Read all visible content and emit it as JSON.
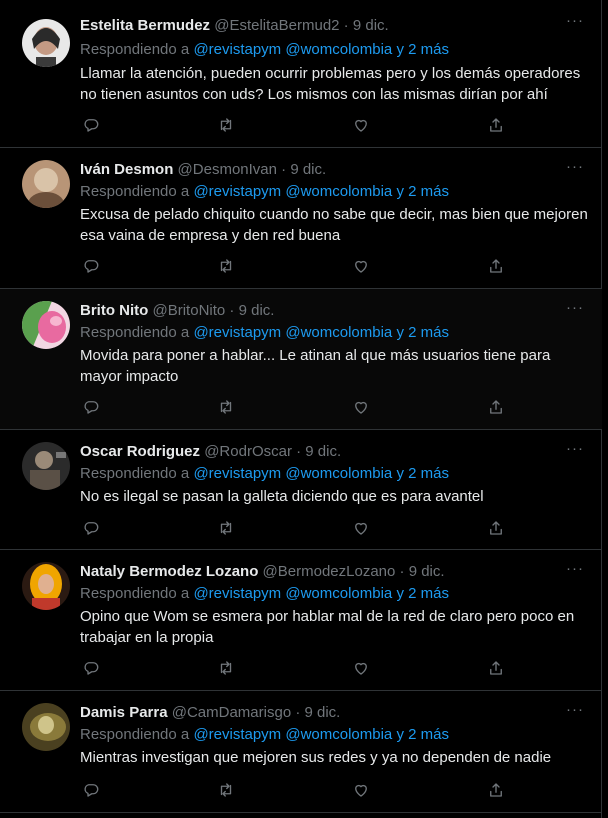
{
  "reply_prefix": "Respondiendo a",
  "mentions": "@revistapym @womcolombia y 2 más",
  "more_label": "···",
  "tweets": [
    {
      "name": "Estelita Bermudez",
      "handle": "@EstelitaBermud2",
      "date": "9 dic.",
      "text": "Llamar la atención, pueden ocurrir problemas pero y los demás operadores no tienen asuntos con uds? Los mismos con las mismas dirían por ahí",
      "avatar_colors": [
        "#e8e8e8",
        "#2a2a2a",
        "#c49a84"
      ]
    },
    {
      "name": "Iván Desmon",
      "handle": "@DesmonIvan",
      "date": "9 dic.",
      "text": "Excusa de pelado chiquito cuando no sabe que decir, mas bien que mejoren esa vaina de empresa y den red buena",
      "avatar_colors": [
        "#b89577",
        "#d9c3a8",
        "#6b4f3a"
      ]
    },
    {
      "name": "Brito Nito",
      "handle": "@BritoNito",
      "date": "9 dic.",
      "text": "Movida para poner a hablar... Le atinan al que más usuarios tiene para mayor impacto",
      "avatar_colors": [
        "#5aa04e",
        "#e86aa0",
        "#f2d6e2"
      ]
    },
    {
      "name": "Oscar Rodriguez",
      "handle": "@RodrOscar",
      "date": "9 dic.",
      "text": "No es ilegal se pasan la galleta diciendo que es para avantel",
      "avatar_colors": [
        "#2b2b2b",
        "#5a5046",
        "#9a8a78"
      ]
    },
    {
      "name": "Nataly Bermodez Lozano",
      "handle": "@BermodezLozano",
      "date": "9 dic.",
      "text": "Opino que Wom se esmera por hablar mal de la red de claro pero poco en trabajar en la propia",
      "avatar_colors": [
        "#f0a500",
        "#c0392b",
        "#2b1a12"
      ]
    },
    {
      "name": "Damis Parra",
      "handle": "@CamDamarisgo",
      "date": "9 dic.",
      "text": "Mientras investigan que mejoren sus redes y ya no dependen de nadie",
      "avatar_colors": [
        "#8a7a3a",
        "#cfc48a",
        "#4a4020"
      ]
    }
  ]
}
